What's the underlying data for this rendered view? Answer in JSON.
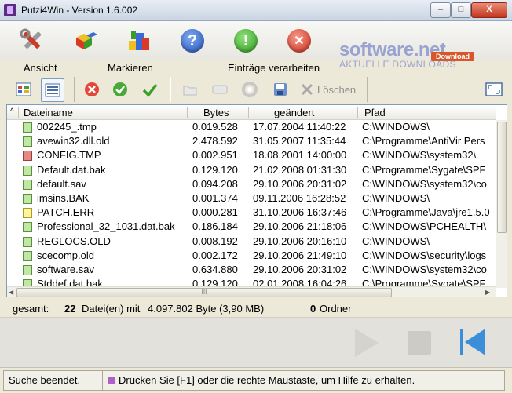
{
  "window": {
    "title": "Putzi4Win - Version 1.6.002",
    "min_label": "–",
    "max_label": "□",
    "close_label": "X"
  },
  "watermark": {
    "main": "software.net",
    "sub": "AKTUELLE DOWNLOADS",
    "badge": "Download"
  },
  "toolbar": {
    "info_glyph": "!",
    "help_glyph": "?",
    "close_glyph": "✕",
    "icons": [
      "tools-icon",
      "cubes-icon",
      "settings-blocks-icon",
      "help-icon",
      "info-icon",
      "close-icon"
    ]
  },
  "groups": {
    "ansicht": "Ansicht",
    "markieren": "Markieren",
    "eintraege": "Einträge verarbeiten"
  },
  "actions": {
    "loeschen": "Löschen"
  },
  "table": {
    "headers": {
      "sort": "^",
      "name": "Dateiname",
      "bytes": "Bytes",
      "date": "geändert",
      "path": "Pfad"
    },
    "rows": [
      {
        "name": "002245_.tmp",
        "bytes": "0.019.528",
        "date": "17.07.2004 11:40:22",
        "path": "C:\\WINDOWS\\",
        "icon": "green"
      },
      {
        "name": "avewin32.dll.old",
        "bytes": "2.478.592",
        "date": "31.05.2007 11:35:44",
        "path": "C:\\Programme\\AntiVir Pers",
        "icon": "green"
      },
      {
        "name": "CONFIG.TMP",
        "bytes": "0.002.951",
        "date": "18.08.2001 14:00:00",
        "path": "C:\\WINDOWS\\system32\\",
        "icon": "red"
      },
      {
        "name": "Default.dat.bak",
        "bytes": "0.129.120",
        "date": "21.02.2008 01:31:30",
        "path": "C:\\Programme\\Sygate\\SPF",
        "icon": "green"
      },
      {
        "name": "default.sav",
        "bytes": "0.094.208",
        "date": "29.10.2006 20:31:02",
        "path": "C:\\WINDOWS\\system32\\co",
        "icon": "green"
      },
      {
        "name": "imsins.BAK",
        "bytes": "0.001.374",
        "date": "09.11.2006 16:28:52",
        "path": "C:\\WINDOWS\\",
        "icon": "green"
      },
      {
        "name": "PATCH.ERR",
        "bytes": "0.000.281",
        "date": "31.10.2006 16:37:46",
        "path": "C:\\Programme\\Java\\jre1.5.0",
        "icon": "yellow"
      },
      {
        "name": "Professional_32_1031.dat.bak",
        "bytes": "0.186.184",
        "date": "29.10.2006 21:18:06",
        "path": "C:\\WINDOWS\\PCHEALTH\\",
        "icon": "green"
      },
      {
        "name": "REGLOCS.OLD",
        "bytes": "0.008.192",
        "date": "29.10.2006 20:16:10",
        "path": "C:\\WINDOWS\\",
        "icon": "green"
      },
      {
        "name": "scecomp.old",
        "bytes": "0.002.172",
        "date": "29.10.2006 21:49:10",
        "path": "C:\\WINDOWS\\security\\logs",
        "icon": "green"
      },
      {
        "name": "software.sav",
        "bytes": "0.634.880",
        "date": "29.10.2006 20:31:02",
        "path": "C:\\WINDOWS\\system32\\co",
        "icon": "green"
      },
      {
        "name": "Stddef.dat.bak",
        "bytes": "0.129.120",
        "date": "02.01.2008 16:04:26",
        "path": "C:\\Programme\\Sygate\\SPF",
        "icon": "green"
      }
    ],
    "hscroll_grip": "III"
  },
  "summary": {
    "label": "gesamt:",
    "count": "22",
    "count_suffix": "Datei(en) mit",
    "bytes": "4.097.802 Byte (3,90 MB)",
    "folders": "0",
    "folders_label": "Ordner"
  },
  "status": {
    "left": "Suche beendet.",
    "hint": "Drücken Sie [F1] oder die rechte Maustaste, um Hilfe zu erhalten."
  }
}
